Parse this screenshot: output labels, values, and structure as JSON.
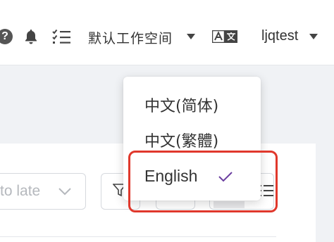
{
  "header": {
    "workspace_label": "默认工作空间",
    "username": "ljqtest",
    "help_glyph": "?"
  },
  "toolbar": {
    "date_placeholder": "to late"
  },
  "language_menu": {
    "items": [
      {
        "label": "中文(简体)",
        "selected": false
      },
      {
        "label": "中文(繁體)",
        "selected": false
      },
      {
        "label": "English",
        "selected": true
      }
    ]
  },
  "colors": {
    "accent_check": "#6b3fa0",
    "highlight_border": "#e0382c",
    "icon": "#444444"
  },
  "icons": [
    "help-icon",
    "bell-icon",
    "todo-list-icon",
    "chevron-down-icon",
    "language-icon",
    "filter-icon",
    "list-icon",
    "check-icon"
  ]
}
